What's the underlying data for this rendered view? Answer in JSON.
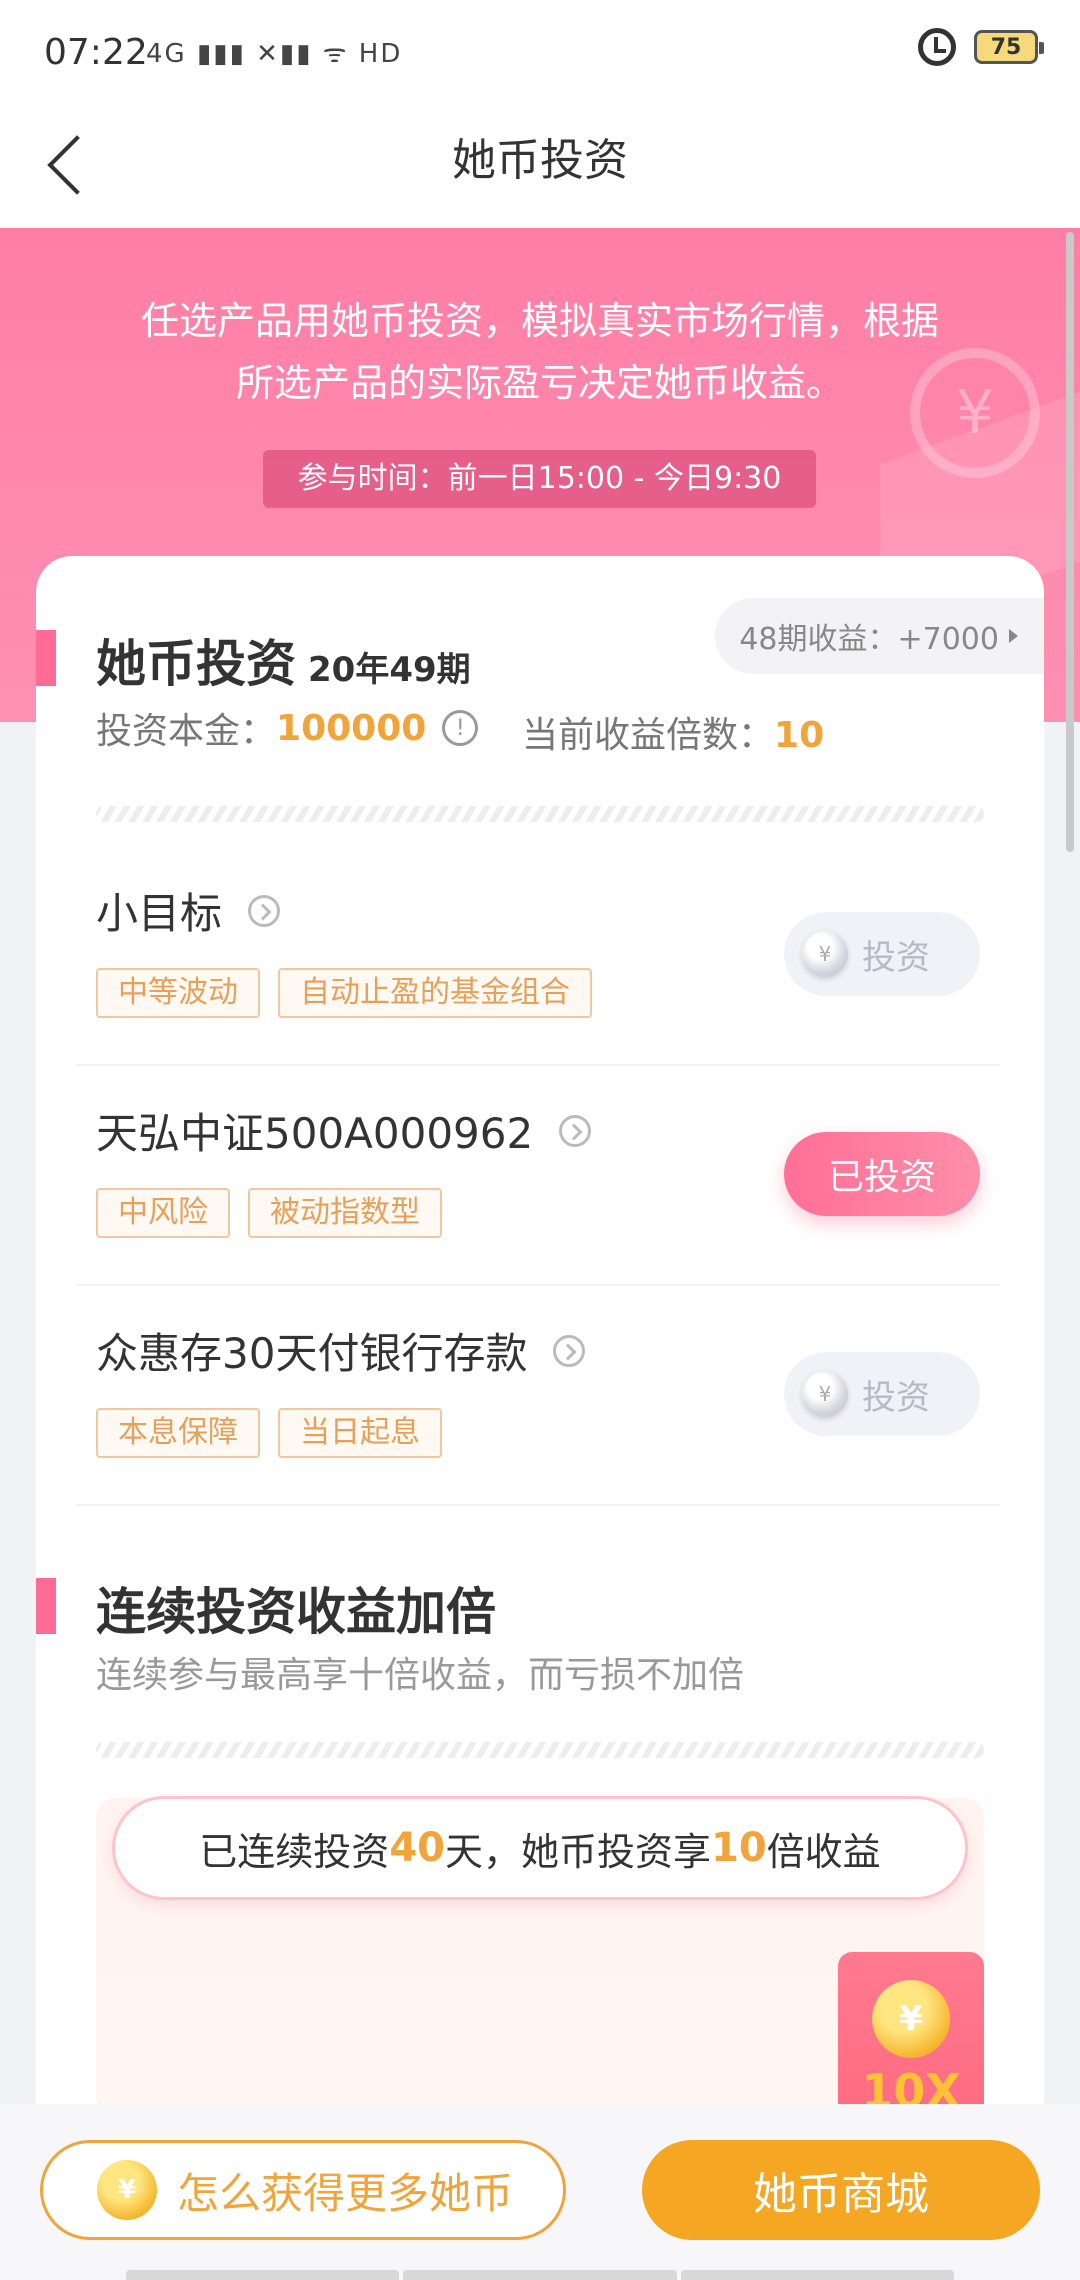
{
  "status_bar": {
    "time": "07:22",
    "signal": "4G ▮▮▮ ✕▮▮ ᯤ HD",
    "battery": "75"
  },
  "nav": {
    "title": "她币投资"
  },
  "hero": {
    "line1": "任选产品用她币投资，模拟真实市场行情，根据",
    "line2": "所选产品的实际盈亏决定她币收益。",
    "participation_time": "参与时间：前一日15:00 - 今日9:30",
    "deco_icon": "yuan-coin-icon"
  },
  "investment": {
    "title": "她币投资",
    "period": "20年49期",
    "last_earnings": "48期收益：+7000",
    "principal_label": "投资本金：",
    "principal_value": "100000",
    "multiple_label": "当前收益倍数：",
    "multiple_value": "10"
  },
  "products": [
    {
      "name": "小目标",
      "tags": [
        "中等波动",
        "自动止盈的基金组合"
      ],
      "button": "投资",
      "invested": false
    },
    {
      "name": "天弘中证500A000962",
      "tags": [
        "中风险",
        "被动指数型"
      ],
      "button": "已投资",
      "invested": true
    },
    {
      "name": "众惠存30天付银行存款",
      "tags": [
        "本息保障",
        "当日起息"
      ],
      "button": "投资",
      "invested": false
    }
  ],
  "streak": {
    "title": "连续投资收益加倍",
    "subtitle": "连续参与最高享十倍收益，而亏损不加倍",
    "pill_prefix": "已连续投资",
    "days": "40",
    "pill_middle": "天，她币投资享",
    "multiple": "10",
    "pill_suffix": "倍收益",
    "badge": "10X",
    "coin_symbol": "¥"
  },
  "bottom": {
    "how_to_get": "怎么获得更多她币",
    "mall": "她币商城"
  },
  "colors": {
    "brand_pink": "#ff7ea6",
    "accent_orange": "#f0a43a",
    "mall_orange": "#f5a623"
  }
}
